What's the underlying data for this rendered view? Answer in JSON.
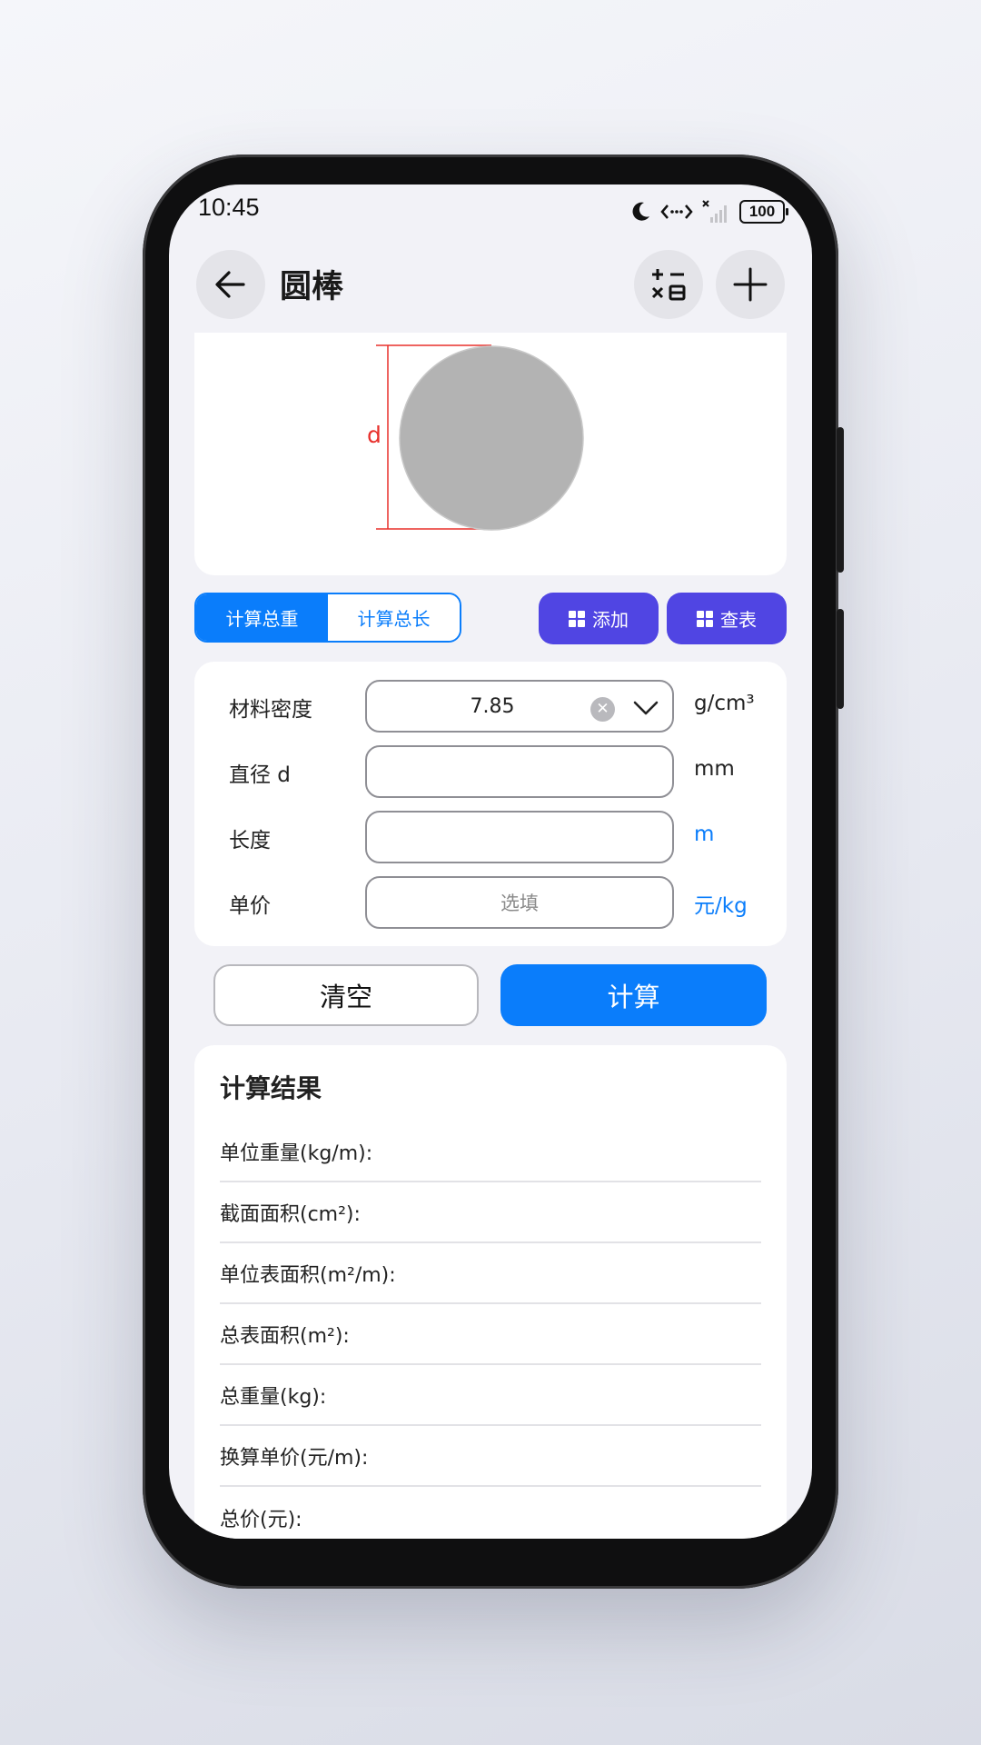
{
  "status_bar": {
    "time": "10:45",
    "battery": "100",
    "icons": [
      "moon-icon",
      "data-transfer-icon",
      "no-signal-icon",
      "battery-icon"
    ]
  },
  "header": {
    "title": "圆棒",
    "back_icon": "arrow-left-icon",
    "calculator_icon": "calculator-icon",
    "add_icon": "plus-icon"
  },
  "diagram": {
    "dimension_label": "d",
    "shape_color": "#b3b3b3",
    "dimension_color": "#e8302c"
  },
  "mode_tabs": [
    {
      "label": "计算总重",
      "active": true
    },
    {
      "label": "计算总长",
      "active": false
    }
  ],
  "actions": {
    "add_label": "添加",
    "table_label": "查表"
  },
  "form": {
    "density": {
      "label": "材料密度",
      "value": "7.85",
      "unit": "g/cm³"
    },
    "diameter": {
      "label": "直径 d",
      "value": "",
      "unit": "mm"
    },
    "length": {
      "label": "长度",
      "value": "",
      "unit": "m"
    },
    "price": {
      "label": "单价",
      "placeholder": "选填",
      "unit": "元/kg"
    }
  },
  "buttons": {
    "clear": "清空",
    "calculate": "计算"
  },
  "results": {
    "title": "计算结果",
    "rows": [
      "单位重量(kg/m):",
      "截面面积(cm²):",
      "单位表面积(m²/m):",
      "总表面积(m²):",
      "总重量(kg):",
      "换算单价(元/m):",
      "总价(元):"
    ]
  },
  "colors": {
    "accent_blue": "#0a7dfb",
    "accent_purple": "#5045e3",
    "background": "#f2f2f7"
  }
}
